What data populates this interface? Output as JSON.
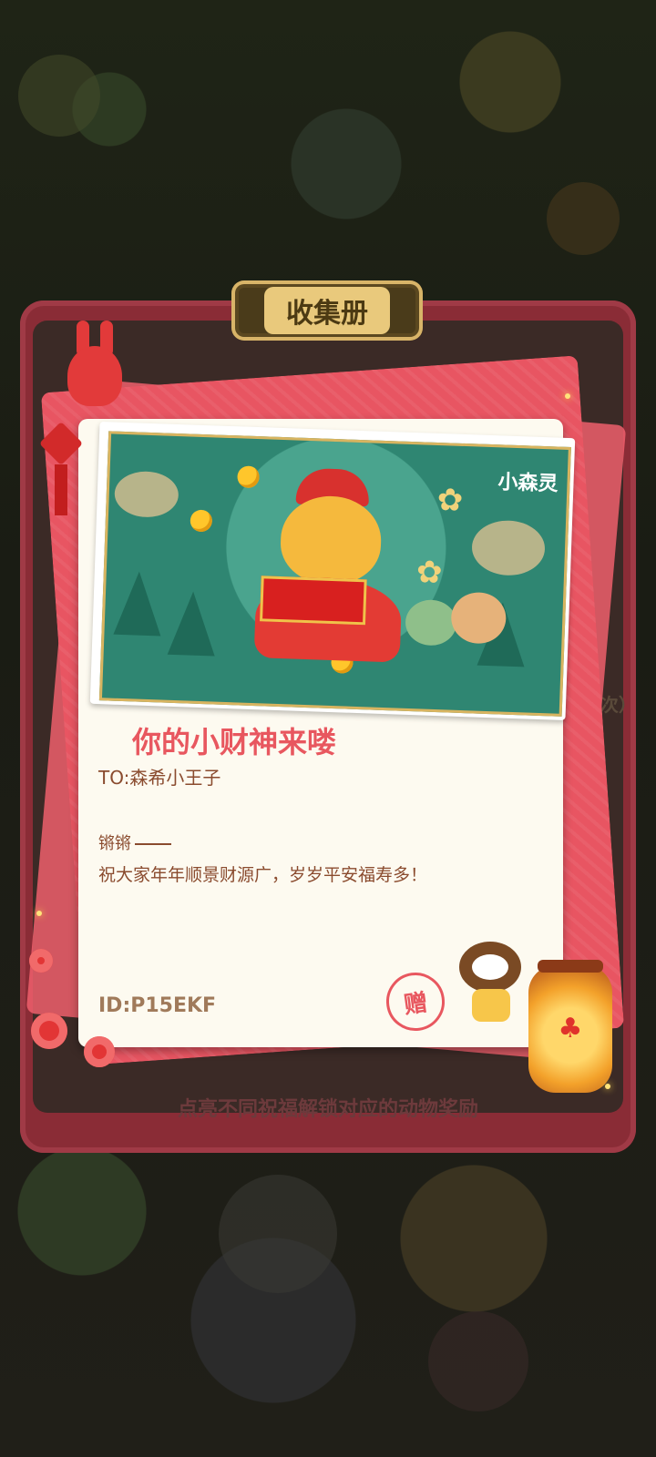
{
  "album": {
    "title": "收集册",
    "hint": "点亮不同祝福解锁对应的动物奖励",
    "side_text": "0次）"
  },
  "card": {
    "title": "你的小财神来喽",
    "to_line": "TO:森希小王子",
    "from_line": "锵锵",
    "message": "祝大家年年顺景财源广，岁岁平安福寿多！",
    "id_line": "ID:P15EKF",
    "stamp_text": "赠",
    "photo_logo": "小森灵"
  },
  "colors": {
    "album_frame": "#8a2c36",
    "envelope": "#e85562",
    "card_bg": "#fdfaf0",
    "title_red": "#e8575f",
    "text_brown": "#8a4b2e"
  },
  "icons": {
    "bunny": "red-bunny-icon",
    "tassel": "chinese-knot-icon",
    "hamster": "hamster-character-icon",
    "lantern": "lantern-icon",
    "plum": "plum-blossom-icon",
    "stamp": "gift-stamp-icon"
  }
}
